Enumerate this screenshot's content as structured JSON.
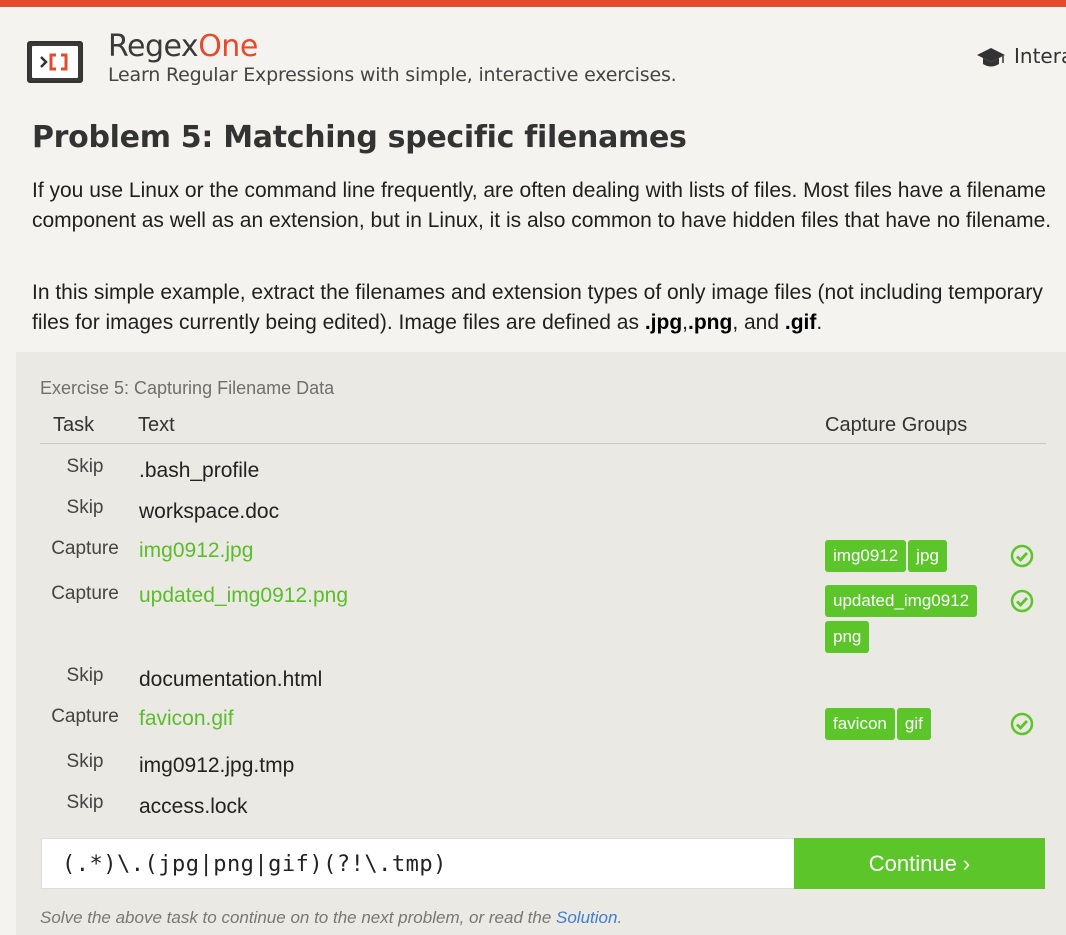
{
  "header": {
    "brand_part1": "Regex",
    "brand_part2": "One",
    "tagline": "Learn Regular Expressions with simple, interactive exercises.",
    "nav_label": "Intera",
    "nav_icon": "graduation-cap-icon",
    "accent_color": "#e44b2d"
  },
  "problem": {
    "title": "Problem 5: Matching specific filenames",
    "paragraph1": "If you use Linux or the command line frequently, are often dealing with lists of files. Most files have a filename component as well as an extension, but in Linux, it is also common to have hidden files that have no filename.",
    "paragraph2_intro": "In this simple example, extract the filenames and extension types of only image files (not including temporary files for images currently being edited). Image files are defined as ",
    "ext_jpg": ".jpg",
    "ext_sep": ",",
    "ext_png": ".png",
    "and_text": ", and ",
    "ext_gif": ".gif",
    "period": "."
  },
  "exercise": {
    "title": "Exercise 5: Capturing Filename Data",
    "headers": {
      "task": "Task",
      "text": "Text",
      "capture_groups": "Capture Groups"
    },
    "rows": [
      {
        "task": "Skip",
        "text": ".bash_profile"
      },
      {
        "task": "Skip",
        "text": "workspace.doc"
      },
      {
        "task": "Capture",
        "text": "img0912.jpg",
        "groups": [
          "img0912",
          "jpg"
        ],
        "status": "check-circle-icon"
      },
      {
        "task": "Capture",
        "text": "updated_img0912.png",
        "groups": [
          "updated_img0912",
          "png"
        ],
        "status": "check-circle-icon"
      },
      {
        "task": "Skip",
        "text": "documentation.html"
      },
      {
        "task": "Capture",
        "text": "favicon.gif",
        "groups": [
          "favicon",
          "gif"
        ],
        "status": "check-circle-icon"
      },
      {
        "task": "Skip",
        "text": "img0912.jpg.tmp"
      },
      {
        "task": "Skip",
        "text": "access.lock"
      }
    ],
    "regex_value": "(.*)\\.(jpg|png|gif)(?!\\.tmp)",
    "continue_label": "Continue ›",
    "footnote_text": "Solve the above task to continue on to the next problem, or read the ",
    "solution_link": "Solution",
    "footnote_end": ".",
    "success_color": "#5bc52a"
  }
}
